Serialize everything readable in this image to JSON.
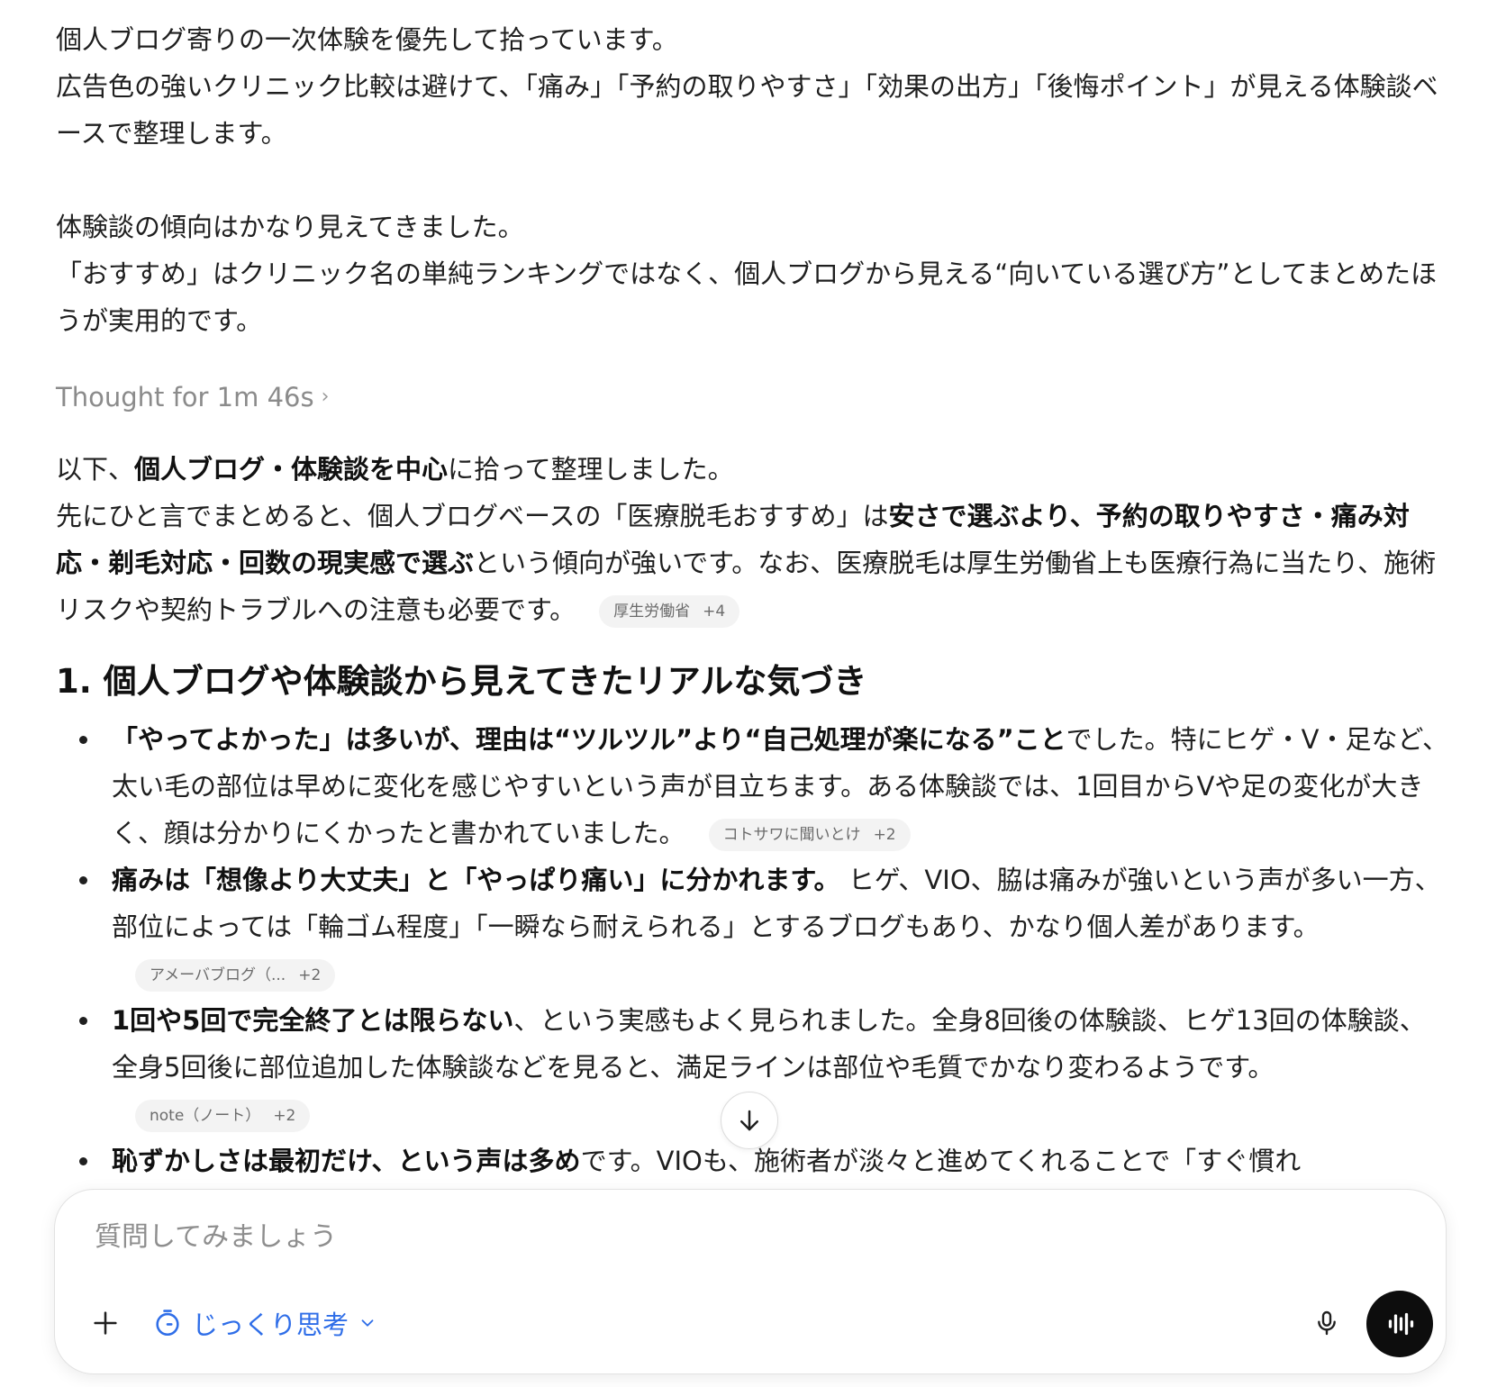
{
  "conversation": {
    "intro": {
      "line1": "個人ブログ寄りの一次体験を優先して拾っています。",
      "line2": "広告色の強いクリニック比較は避けて、「痛み」「予約の取りやすさ」「効果の出方」「後悔ポイント」が見える体験談ベースで整理します。",
      "line3": "体験談の傾向はかなり見えてきました。",
      "line4": "「おすすめ」はクリニック名の単純ランキングではなく、個人ブログから見える“向いている選び方”としてまとめたほうが実用的です。"
    },
    "thought_label": "Thought for 1m 46s",
    "answer": {
      "p1_a": "以下、",
      "p1_b": "個人ブログ・体験談を中心",
      "p1_c": "に拾って整理しました。",
      "p2_a": "先にひと言でまとめると、個人ブログベースの「医療脱毛おすすめ」は",
      "p2_b": "安さで選ぶより、予約の取りやすさ・痛み対応・剃毛対応・回数の現実感で選ぶ",
      "p2_c": "という傾向が強いです。なお、医療脱毛は厚生労働省上も医療行為に当たり、施術リスクや契約トラブルへの注意も必要です。",
      "p2_chip_label": "厚生労働省",
      "p2_chip_count": "+4"
    },
    "section1": {
      "heading": "1. 個人ブログや体験談から見えてきたリアルな気づき",
      "bullets": [
        {
          "bold": "「やってよかった」は多いが、理由は“ツルツル”より“自己処理が楽になる”こと",
          "text": "でした。特にヒゲ・V・足など、太い毛の部位は早めに変化を感じやすいという声が目立ちます。ある体験談では、1回目からVや足の変化が大きく、顔は分かりにくかったと書かれていました。",
          "chip_label": "コトサワに聞いとけ",
          "chip_count": "+2"
        },
        {
          "bold": "痛みは「想像より大丈夫」と「やっぱり痛い」に分かれます。",
          "text": " ヒゲ、VIO、脇は痛みが強いという声が多い一方、部位によっては「輪ゴム程度」「一瞬なら耐えられる」とするブログもあり、かなり個人差があります。",
          "chip_label": "アメーバブログ（...",
          "chip_count": "+2"
        },
        {
          "bold": "1回や5回で完全終了とは限らない",
          "text": "、という実感もよく見られました。全身8回後の体験談、ヒゲ13回の体験談、全身5回後に部位追加した体験談などを見ると、満足ラインは部位や毛質でかなり変わるようです。",
          "chip_label": "note（ノート）",
          "chip_count": "+2"
        },
        {
          "bold": "恥ずかしさは最初だけ、という声は多め",
          "text": "です。VIOも、施術者が淡々と進めてくれることで「すぐ慣れ",
          "chip_label": "",
          "chip_count": ""
        }
      ]
    }
  },
  "composer": {
    "placeholder": "質問してみましょう",
    "mode_label": "じっくり思考"
  },
  "icons": {
    "scroll_down": "arrow-down-icon",
    "add": "plus-icon",
    "mode": "timer-icon",
    "mode_chevron": "chevron-down-icon",
    "mic": "microphone-icon",
    "voice": "waveform-icon"
  },
  "colors": {
    "accent_blue": "#2f6ee8",
    "voice_button": "#0d0d0d",
    "chip_bg": "#f3f3f3"
  }
}
